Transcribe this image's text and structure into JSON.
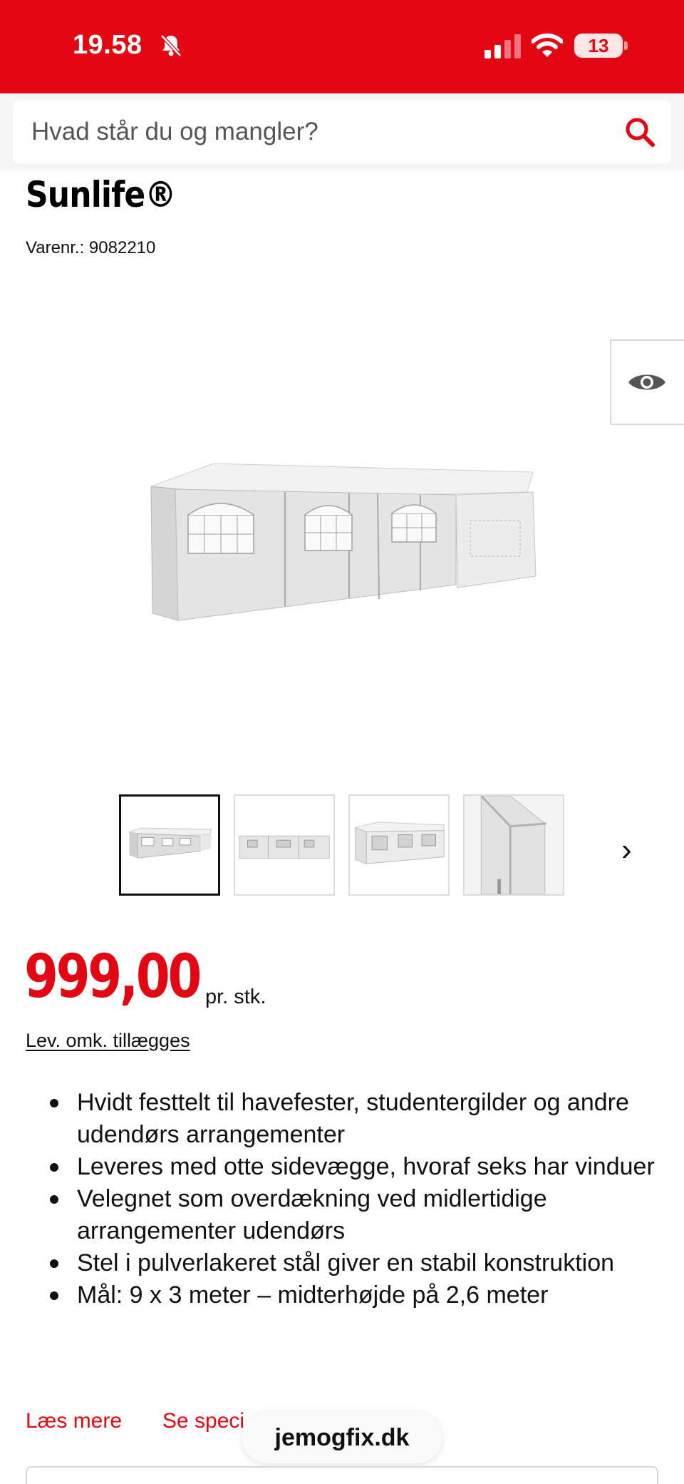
{
  "status_bar": {
    "time": "19.58",
    "battery": "13",
    "icons": [
      "bell-off-icon",
      "signal-icon",
      "wifi-icon",
      "battery-icon"
    ]
  },
  "search": {
    "placeholder": "Hvad står du og mangler?",
    "icon": "search-icon"
  },
  "product": {
    "brand": "Sunlife®",
    "item_number": "Varenr.: 9082210",
    "view_icon": "eye-icon",
    "thumbnails_next": "›",
    "price": "999,00",
    "price_unit": "pr. stk.",
    "delivery_note": "Lev. omk. tillægges",
    "bullets": [
      "Hvidt festtelt til havefester, studentergilder og andre udendørs arrangementer",
      "Leveres med otte sidevægge, hvoraf seks har vinduer",
      "Velegnet som overdækning ved midlertidige arrangementer udendørs",
      "Stel i pulverlakeret stål giver en stabil konstruktion",
      "Mål: 9 x 3 meter – midterhøjde på 2,6 meter"
    ],
    "read_more": "Læs mere",
    "see_spec": "Se speci"
  },
  "browser": {
    "domain": "jemogfix.dk"
  },
  "colors": {
    "brand_red": "#e30613",
    "text": "#111111"
  }
}
